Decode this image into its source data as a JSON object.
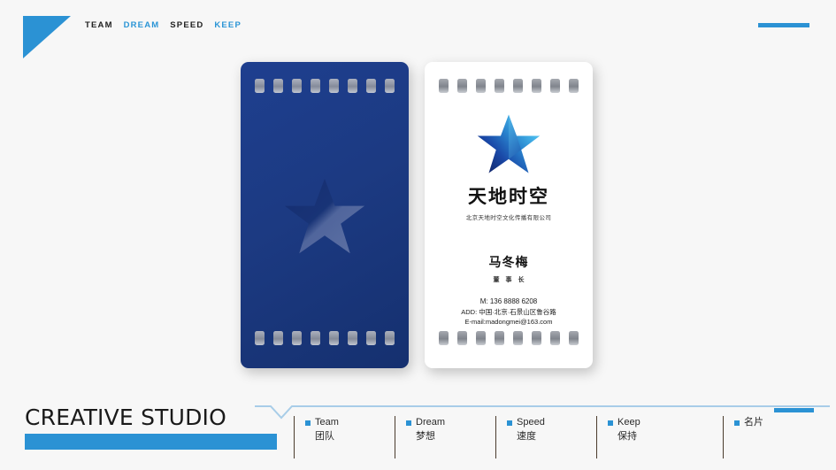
{
  "header": {
    "logo_icon": "triangle-logo-icon",
    "nav": [
      {
        "label": "TEAM",
        "style": "dark"
      },
      {
        "label": "DREAM",
        "style": "blue"
      },
      {
        "label": "SPEED",
        "style": "dark"
      },
      {
        "label": "KEEP",
        "style": "blue"
      }
    ]
  },
  "cards": {
    "blue_card": {
      "watermark_icon": "film-star-watermark-icon",
      "perforation_count": 8
    },
    "white_card": {
      "perforation_count": 8,
      "logo": {
        "icon": "film-star-logo-icon",
        "wordmark": "天地时空",
        "subtitle": "北京天地时空文化传播有限公司"
      },
      "person": {
        "name": "马冬梅",
        "title": "董事长"
      },
      "contact": {
        "phone": "M: 136 8888 6208",
        "address": "ADD: 中国·北京·石景山区鲁谷路",
        "email": "E-mail:madongmei@163.com"
      }
    }
  },
  "footer": {
    "title": "CREATIVE STUDIO",
    "items": [
      {
        "en": "Team",
        "cn": "团队"
      },
      {
        "en": "Dream",
        "cn": "梦想"
      },
      {
        "en": "Speed",
        "cn": "速度"
      },
      {
        "en": "Keep",
        "cn": "保持"
      },
      {
        "en": "",
        "cn": "名片"
      }
    ]
  },
  "colors": {
    "accent_blue": "#2b92d4",
    "card_navy": "#1c3a82",
    "background": "#f7f7f7",
    "star_light": "#3fb3e8",
    "star_dark": "#16307a"
  }
}
